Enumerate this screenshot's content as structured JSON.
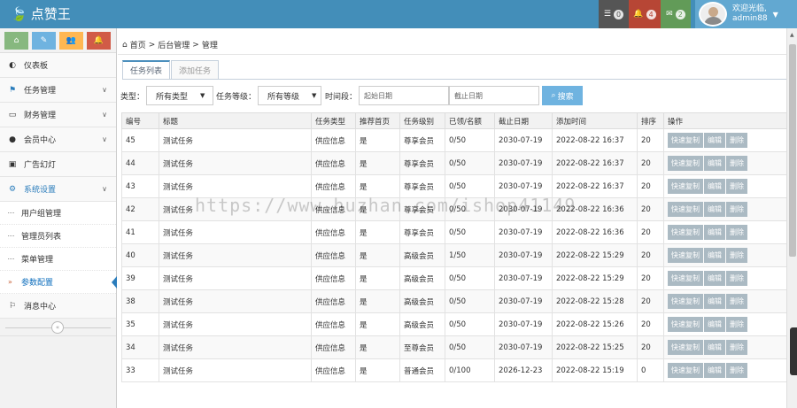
{
  "app": {
    "brand": "点赞王"
  },
  "header": {
    "badges": [
      {
        "icon": "tasks-icon",
        "count": "0",
        "color": "#555555"
      },
      {
        "icon": "bell-icon",
        "count": "4",
        "color": "#b74635"
      },
      {
        "icon": "envelope-icon",
        "count": "2",
        "color": "#629b58"
      }
    ],
    "user": {
      "greeting": "欢迎光临,",
      "name": "admin88"
    }
  },
  "sidebar": {
    "shortcut_colors": [
      "#87b87f",
      "#6fb3e0",
      "#ffb752",
      "#d15b47"
    ],
    "items": [
      {
        "label": "仪表板",
        "icon": "dashboard-icon"
      },
      {
        "label": "任务管理",
        "icon": "flag-icon"
      },
      {
        "label": "财务管理",
        "icon": "wallet-icon"
      },
      {
        "label": "会员中心",
        "icon": "user-icon"
      },
      {
        "label": "广告幻灯",
        "icon": "picture-icon"
      },
      {
        "label": "系统设置",
        "icon": "gear-icon"
      }
    ],
    "subitems": [
      "用户组管理",
      "管理员列表",
      "菜单管理",
      "参数配置"
    ],
    "last_item": {
      "label": "消息中心",
      "icon": "bookmark-icon"
    },
    "collapse_glyph": "«"
  },
  "breadcrumb": {
    "home": "首页",
    "sep": ">",
    "level1": "后台管理",
    "level2": "管理"
  },
  "tabs": [
    "任务列表",
    "添加任务"
  ],
  "filters": {
    "type_label": "类型：",
    "type_value": "所有类型",
    "level_label": "任务等级：",
    "level_value": "所有等级",
    "date_label": "时间段：",
    "start_placeholder": "起始日期",
    "end_placeholder": "截止日期",
    "search_label": "搜索"
  },
  "table": {
    "headers": [
      "编号",
      "标题",
      "任务类型",
      "推荐首页",
      "任务级别",
      "已领/名额",
      "截止日期",
      "添加时间",
      "排序",
      "操作"
    ],
    "actions": [
      "快速复制",
      "编辑",
      "删除"
    ],
    "rows": [
      [
        "45",
        "测试任务",
        "供应信息",
        "是",
        "尊享会员",
        "0/50",
        "2030-07-19",
        "2022-08-22 16:37",
        "20"
      ],
      [
        "44",
        "测试任务",
        "供应信息",
        "是",
        "尊享会员",
        "0/50",
        "2030-07-19",
        "2022-08-22 16:37",
        "20"
      ],
      [
        "43",
        "测试任务",
        "供应信息",
        "是",
        "尊享会员",
        "0/50",
        "2030-07-19",
        "2022-08-22 16:37",
        "20"
      ],
      [
        "42",
        "测试任务",
        "供应信息",
        "是",
        "尊享会员",
        "0/50",
        "2030-07-19",
        "2022-08-22 16:36",
        "20"
      ],
      [
        "41",
        "测试任务",
        "供应信息",
        "是",
        "尊享会员",
        "0/50",
        "2030-07-19",
        "2022-08-22 16:36",
        "20"
      ],
      [
        "40",
        "测试任务",
        "供应信息",
        "是",
        "高级会员",
        "1/50",
        "2030-07-19",
        "2022-08-22 15:29",
        "20"
      ],
      [
        "39",
        "测试任务",
        "供应信息",
        "是",
        "高级会员",
        "0/50",
        "2030-07-19",
        "2022-08-22 15:29",
        "20"
      ],
      [
        "38",
        "测试任务",
        "供应信息",
        "是",
        "高级会员",
        "0/50",
        "2030-07-19",
        "2022-08-22 15:28",
        "20"
      ],
      [
        "35",
        "测试任务",
        "供应信息",
        "是",
        "高级会员",
        "0/50",
        "2030-07-19",
        "2022-08-22 15:26",
        "20"
      ],
      [
        "34",
        "测试任务",
        "供应信息",
        "是",
        "至尊会员",
        "0/50",
        "2030-07-19",
        "2022-08-22 15:25",
        "20"
      ],
      [
        "33",
        "测试任务",
        "供应信息",
        "是",
        "普通会员",
        "0/100",
        "2026-12-23",
        "2022-08-22 15:19",
        "0"
      ]
    ]
  },
  "watermark": "https://www.huzhan.com/ishop41149"
}
